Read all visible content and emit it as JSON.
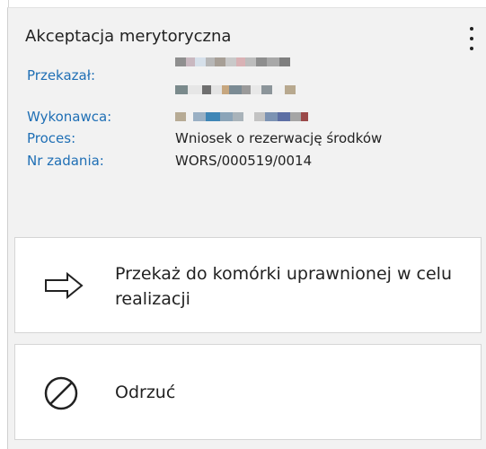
{
  "task": {
    "title": "Akceptacja merytoryczna",
    "menu_icon": "kebab-menu-icon",
    "fields": [
      {
        "label": "Przekazał:",
        "value": ""
      },
      {
        "label": "Wykonawca:",
        "value": ""
      },
      {
        "label": "Proces:",
        "value": "Wniosek o rezerwację środków"
      },
      {
        "label": "Nr zadania:",
        "value": "WORS/000519/0014"
      }
    ]
  },
  "actions": [
    {
      "label": "Przekaż do komórki uprawnionej w celu realizacji",
      "icon": "arrow-right-icon"
    },
    {
      "label": "Odrzuć",
      "icon": "reject-circle-icon"
    }
  ],
  "colors": {
    "label": "#1f6fb5",
    "panel_bg": "#f2f2f2",
    "card_bg": "#ffffff"
  }
}
